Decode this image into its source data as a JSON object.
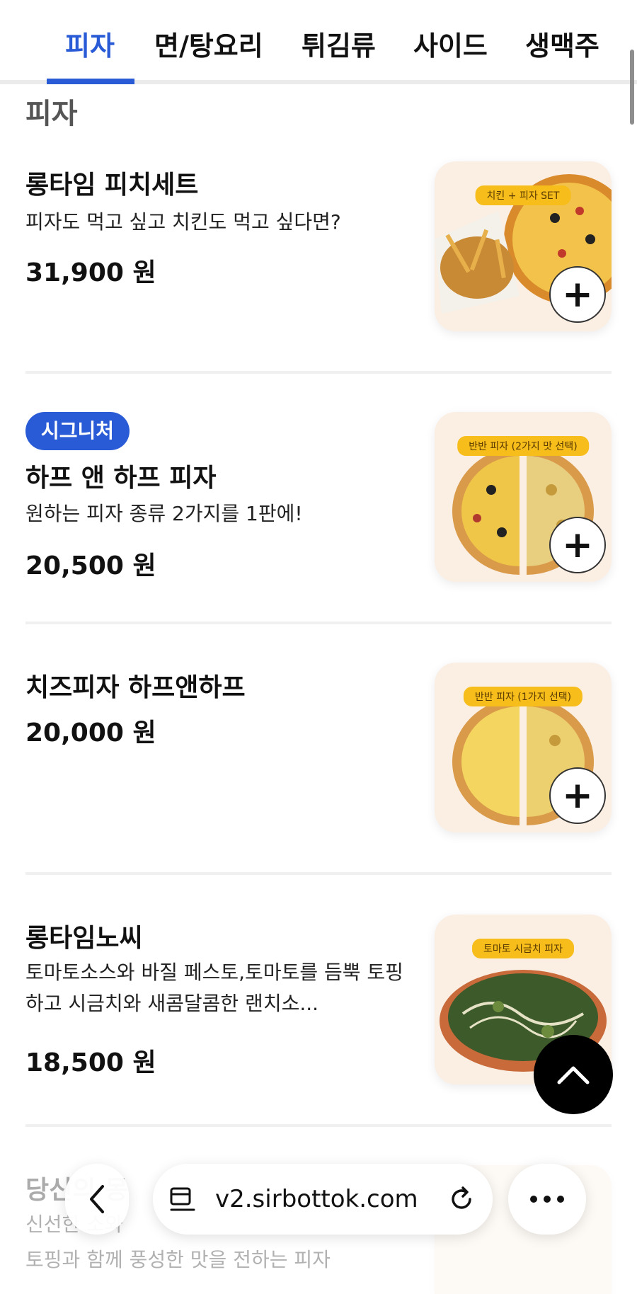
{
  "tabs": [
    {
      "label": "피자"
    },
    {
      "label": "면/탕요리"
    },
    {
      "label": "튀김류"
    },
    {
      "label": "사이드"
    },
    {
      "label": "생맥주"
    }
  ],
  "section": {
    "title": "피자"
  },
  "items": [
    {
      "name": "롱타임 피치세트",
      "desc": "피자도 먹고 싶고 치킨도 먹고 싶다면?",
      "price": "31,900 원",
      "thumb_label": "치킨 + 피자 SET"
    },
    {
      "badge": "시그니처",
      "name": "하프 앤 하프 피자",
      "desc": "원하는 피자 종류 2가지를 1판에!",
      "price": "20,500 원",
      "thumb_label": "반반 피자 (2가지 맛 선택)"
    },
    {
      "name": "치즈피자 하프앤하프",
      "price": "20,000 원",
      "thumb_label": "반반 피자 (1가지 선택)"
    },
    {
      "name": "롱타임노씨",
      "desc": "토마토소스와 바질 페스토,토마토를 듬뿍 토핑하고 시금치와 새콤달콤한 랜치소...",
      "price": "18,500 원",
      "thumb_label": "토마토 시금치 피자"
    },
    {
      "name": "당신의 몽",
      "desc_line1": "신선한 소와",
      "desc_line2": "토핑과 함께 풍성한 맛을 전하는 피자"
    }
  ],
  "add_symbol": "+",
  "browser": {
    "url": "v2.sirbottok.com"
  },
  "icons": {
    "add": "plus-icon",
    "scroll_top": "chevron-up-icon",
    "back": "chevron-left-icon",
    "tabs": "tab-overview-icon",
    "reload": "reload-icon",
    "more": "more-dots-icon"
  },
  "colors": {
    "accent": "#2a5bd7",
    "label_yellow": "#f6bd1b",
    "thumb_bg": "#fbefe4"
  }
}
